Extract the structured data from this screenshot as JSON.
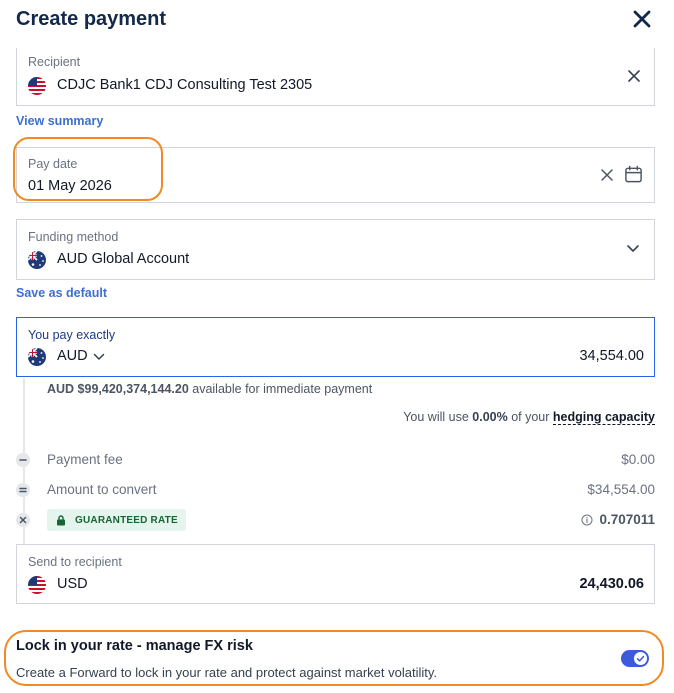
{
  "header": {
    "title": "Create payment",
    "close_icon": "close-icon"
  },
  "recipient": {
    "label": "Recipient",
    "value": "CDJC Bank1 CDJ Consulting Test 2305",
    "flag": "us-flag-icon"
  },
  "links": {
    "view_summary": "View summary",
    "save_default": "Save as default"
  },
  "pay_date": {
    "label": "Pay date",
    "value": "01 May 2026"
  },
  "funding": {
    "label": "Funding method",
    "value": "AUD Global Account",
    "flag": "au-flag-icon"
  },
  "you_pay": {
    "label": "You pay exactly",
    "currency": "AUD",
    "amount": "34,554.00"
  },
  "available": {
    "amount": "AUD $99,420,374,144.20",
    "suffix": " available for immediate payment"
  },
  "hedging": {
    "prefix": "You will use ",
    "percent": "0.00%",
    "middle": " of your ",
    "link": "hedging capacity"
  },
  "breakdown": {
    "payment_fee": {
      "label": "Payment fee",
      "value": "$0.00"
    },
    "amount_to_convert": {
      "label": "Amount to convert",
      "value": "$34,554.00"
    },
    "guaranteed_rate": {
      "badge": "GUARANTEED RATE",
      "value": "0.707011"
    }
  },
  "send": {
    "label": "Send to recipient",
    "currency": "USD",
    "amount": "24,430.06"
  },
  "lockin": {
    "title": "Lock in your rate - manage FX risk",
    "description": "Create a Forward to lock in your rate and protect against market volatility.",
    "enabled": true
  },
  "colors": {
    "accent": "#2563eb",
    "link": "#3b6fd6",
    "title": "#13294b",
    "highlight": "#f08a24",
    "toggle": "#3b5bdb",
    "badge_bg": "#e6f4ee"
  }
}
